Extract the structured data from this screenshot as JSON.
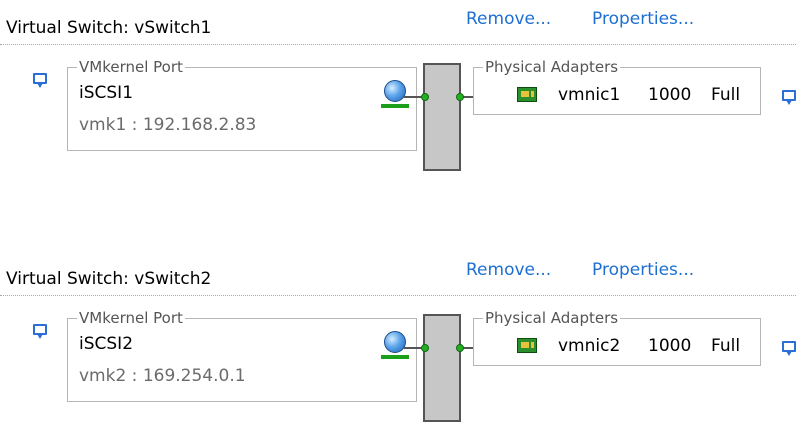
{
  "switches": [
    {
      "title": "Virtual Switch: vSwitch1",
      "remove_label": "Remove...",
      "properties_label": "Properties...",
      "vmkernel": {
        "legend": "VMkernel Port",
        "name": "iSCSI1",
        "vmk": "vmk1 : 192.168.2.83"
      },
      "physical": {
        "legend": "Physical Adapters",
        "nic": "vmnic1",
        "speed": "1000",
        "duplex": "Full"
      }
    },
    {
      "title": "Virtual Switch: vSwitch2",
      "remove_label": "Remove...",
      "properties_label": "Properties...",
      "vmkernel": {
        "legend": "VMkernel Port",
        "name": "iSCSI2",
        "vmk": "vmk2 : 169.254.0.1"
      },
      "physical": {
        "legend": "Physical Adapters",
        "nic": "vmnic2",
        "speed": "1000",
        "duplex": "Full"
      }
    }
  ],
  "colors": {
    "link": "#1d6fd2",
    "port_dot": "#22b022",
    "switch_bar": "#c7c7c7"
  },
  "icons": [
    "speech-bubble-icon",
    "network-globe-icon",
    "nic-card-icon",
    "port-dot-icon"
  ]
}
